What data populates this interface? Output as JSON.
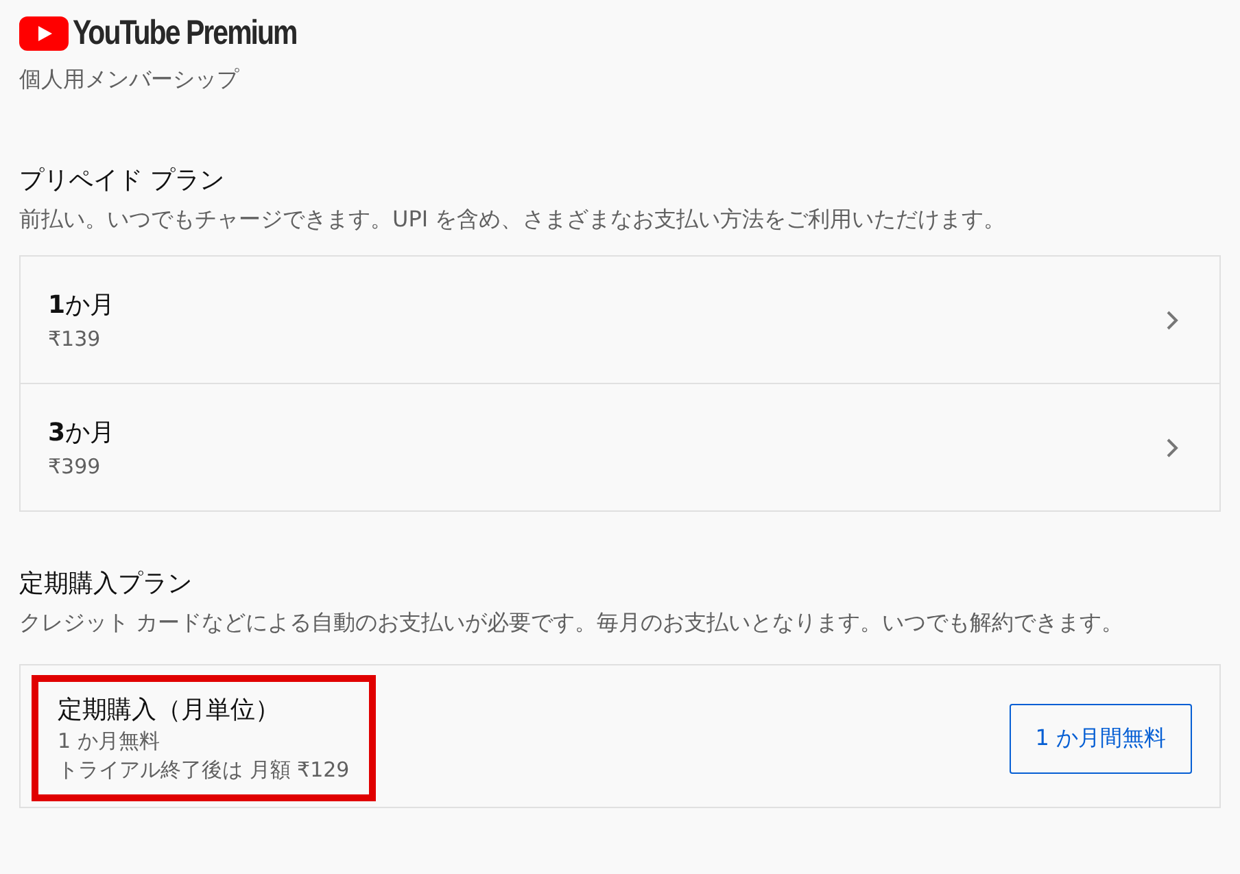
{
  "logo": {
    "text": "YouTube Premium"
  },
  "subtitle": "個人用メンバーシップ",
  "prepaid": {
    "title": "プリペイド プラン",
    "description": "前払い。いつでもチャージできます。UPI を含め、さまざまなお支払い方法をご利用いただけます。",
    "plans": [
      {
        "name": "**1**か月",
        "price": "₹139"
      },
      {
        "name": "**3**か月",
        "price": "₹399"
      }
    ]
  },
  "subscription": {
    "title": "定期購入プラン",
    "description": "クレジット カードなどによる自動のお支払いが必要です。毎月のお支払いとなります。いつでも解約できます。",
    "plans": [
      {
        "name": "定期購入（月単位）",
        "trial": "1 か月無料",
        "after": "トライアル終了後は 月額 ₹129",
        "highlighted": true,
        "button": "1 か月間無料"
      }
    ]
  }
}
